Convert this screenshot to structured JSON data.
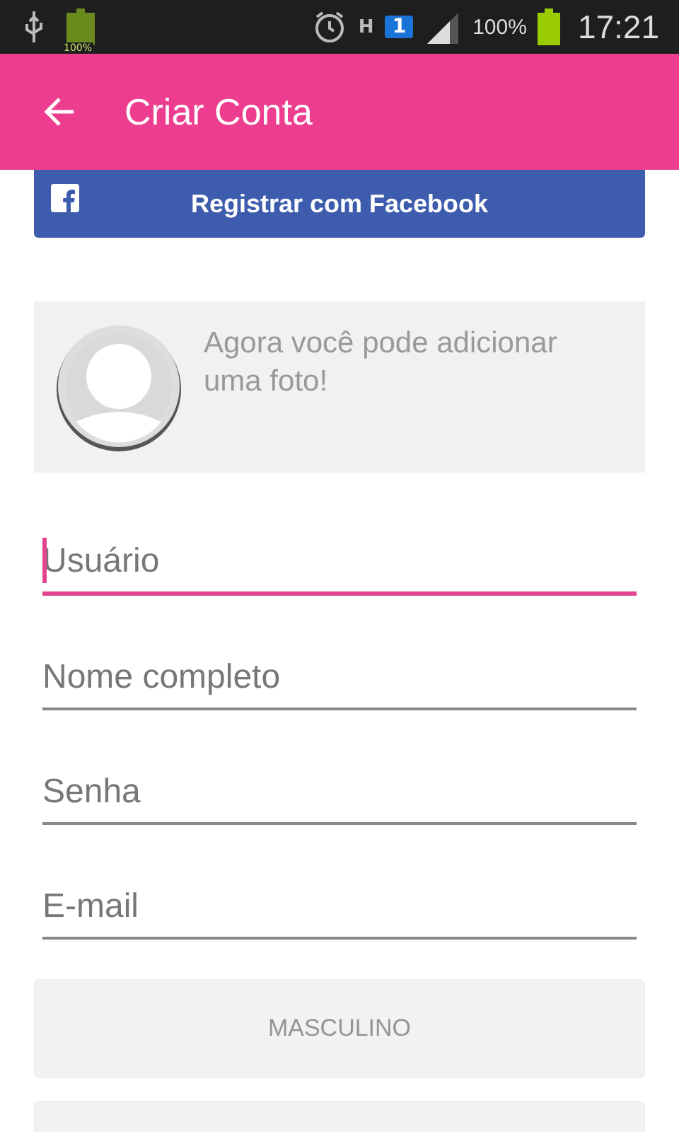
{
  "status_bar": {
    "battery_small_label": "100%",
    "sim_label": "1",
    "network": "H",
    "battery_percent": "100%",
    "time": "17:21"
  },
  "app_bar": {
    "title": "Criar Conta"
  },
  "facebook_button": {
    "label": "Registrar com Facebook"
  },
  "photo_prompt": {
    "text": "Agora você pode adicionar uma foto!"
  },
  "fields": [
    {
      "placeholder": "Usuário",
      "focused": true
    },
    {
      "placeholder": "Nome completo",
      "focused": false
    },
    {
      "placeholder": "Senha",
      "focused": false
    },
    {
      "placeholder": "E-mail",
      "focused": false
    }
  ],
  "gender_options": [
    {
      "kind": "option",
      "label": "MASCULINO"
    },
    {
      "kind": "option"
    }
  ]
}
